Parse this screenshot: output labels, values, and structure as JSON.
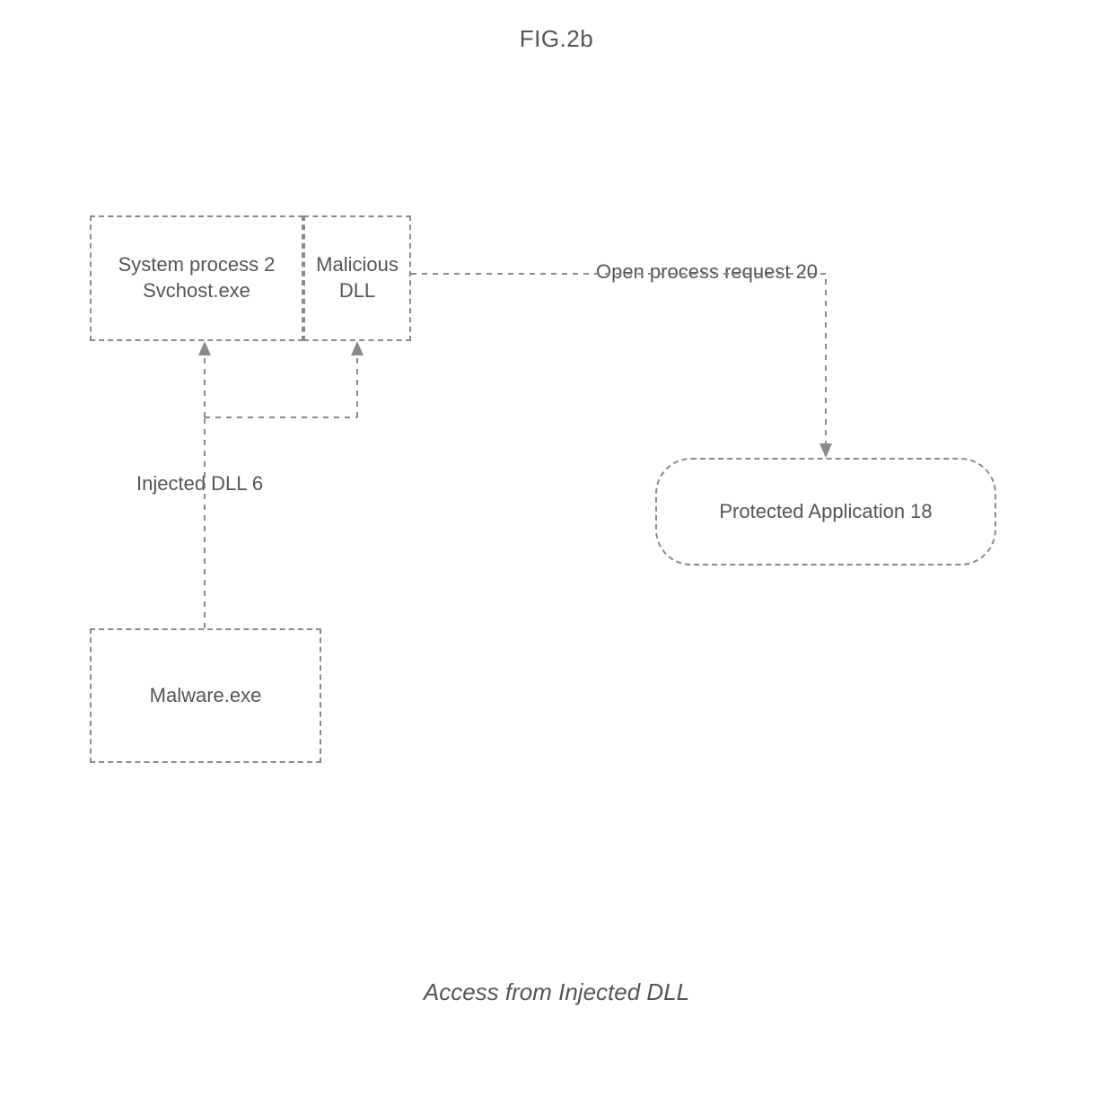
{
  "figure": {
    "title": "FIG.2b",
    "caption": "Access from Injected DLL"
  },
  "nodes": {
    "system_process": {
      "line1": "System process 2",
      "line2": "Svchost.exe"
    },
    "malicious_dll": {
      "line1": "Malicious",
      "line2": "DLL"
    },
    "malware": "Malware.exe",
    "protected_app": "Protected Application  18"
  },
  "edges": {
    "injected_dll": "Injected DLL 6",
    "open_process": "Open process request 20"
  }
}
